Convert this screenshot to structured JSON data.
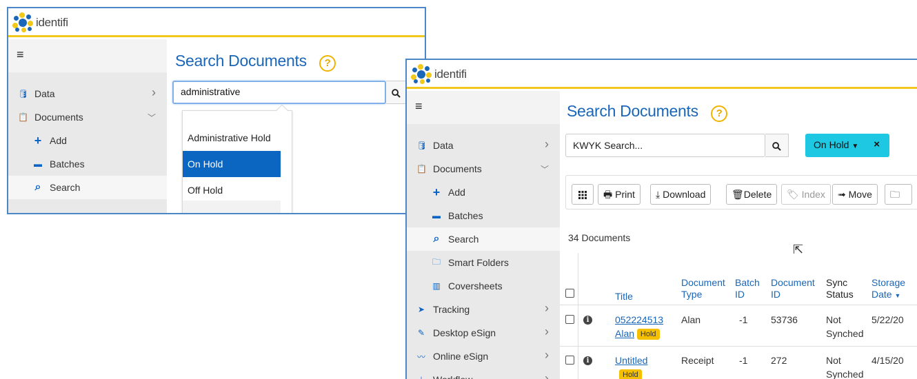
{
  "brand": {
    "name": "identifi"
  },
  "window1": {
    "menu_icon": "≡",
    "title": "Search Documents",
    "help": "?",
    "search": {
      "value": "administrative"
    },
    "dropdown": {
      "items": [
        "Administrative Hold",
        "On Hold",
        "Off Hold"
      ],
      "selected": "On Hold"
    },
    "sidebar": [
      {
        "label": "Data",
        "icon": "database-icon",
        "chevron": true
      },
      {
        "label": "Documents",
        "icon": "clipboard-icon",
        "chevron": true
      },
      {
        "label": "Add",
        "icon": "plus-icon",
        "sub": true
      },
      {
        "label": "Batches",
        "icon": "archive-icon",
        "sub": true
      },
      {
        "label": "Search",
        "icon": "search-icon",
        "sub": true,
        "active": true
      }
    ]
  },
  "window2": {
    "menu_icon": "≡",
    "title": "Search Documents",
    "help": "?",
    "search": {
      "placeholder": "KWYK Search..."
    },
    "filter": {
      "label": "On Hold",
      "close": "×"
    },
    "toolbar": {
      "columns_icon": "grid-icon",
      "print": "Print",
      "download": "Download",
      "delete": "Delete",
      "index": "Index",
      "move": "Move"
    },
    "document_count": "34 Documents",
    "sidebar": [
      {
        "label": "Data",
        "icon": "database-icon",
        "chevron": true
      },
      {
        "label": "Documents",
        "icon": "clipboard-icon",
        "chevron": true
      },
      {
        "label": "Add",
        "icon": "plus-icon",
        "sub": true
      },
      {
        "label": "Batches",
        "icon": "archive-icon",
        "sub": true
      },
      {
        "label": "Search",
        "icon": "search-icon",
        "sub": true,
        "active": true
      },
      {
        "label": "Smart Folders",
        "icon": "folder-icon",
        "sub": true
      },
      {
        "label": "Coversheets",
        "icon": "barcode-icon",
        "sub": true
      },
      {
        "label": "Tracking",
        "icon": "paper-plane-icon",
        "chevron": true
      },
      {
        "label": "Desktop eSign",
        "icon": "pen-icon",
        "chevron": true
      },
      {
        "label": "Online eSign",
        "icon": "signature-icon",
        "chevron": true
      },
      {
        "label": "Workflow",
        "icon": "workflow-icon",
        "chevron": true
      }
    ],
    "table": {
      "headers": {
        "title": "Title",
        "document_type": [
          "Document",
          "Type"
        ],
        "batch_id": [
          "Batch",
          "ID"
        ],
        "document_id": [
          "Document",
          "ID"
        ],
        "sync_status": [
          "Sync",
          "Status"
        ],
        "storage_date": [
          "Storage",
          "Date"
        ]
      },
      "rows": [
        {
          "title": [
            "052224513",
            "Alan"
          ],
          "badge": "Hold",
          "document_type": "Alan",
          "batch_id": "-1",
          "document_id": "53736",
          "sync_status": [
            "Not",
            "Synched"
          ],
          "storage_date": "5/22/20"
        },
        {
          "title": [
            "Untitled"
          ],
          "badge": "Hold",
          "document_type": "Receipt",
          "batch_id": "-1",
          "document_id": "272",
          "sync_status": [
            "Not",
            "Synched"
          ],
          "storage_date": "4/15/20"
        }
      ]
    }
  }
}
